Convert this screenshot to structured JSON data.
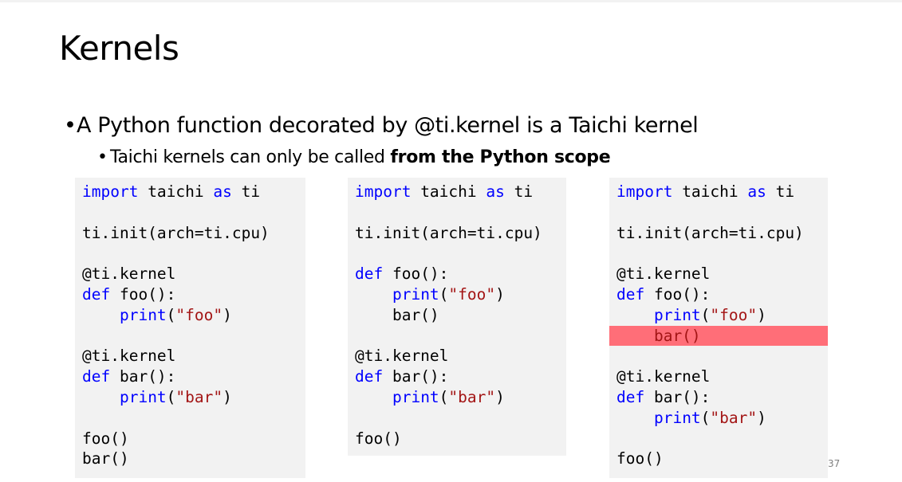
{
  "slide": {
    "title": "Kernels",
    "bullet_text": "A Python function decorated by @ti.kernel is a Taichi kernel",
    "sub_bullet_prefix": "Taichi kernels can only be called ",
    "sub_bullet_bold": "from the Python scope",
    "page_number": "37"
  },
  "code_blocks": [
    {
      "lines": [
        [
          {
            "t": "import",
            "c": "kw"
          },
          {
            "t": " taichi ",
            "c": "plain"
          },
          {
            "t": "as",
            "c": "kw"
          },
          {
            "t": " ti",
            "c": "plain"
          }
        ],
        [],
        [
          {
            "t": "ti.init(arch=ti.cpu)",
            "c": "plain"
          }
        ],
        [],
        [
          {
            "t": "@ti.kernel",
            "c": "plain"
          }
        ],
        [
          {
            "t": "def",
            "c": "kw"
          },
          {
            "t": " foo():",
            "c": "plain"
          }
        ],
        [
          {
            "t": "    ",
            "c": "plain"
          },
          {
            "t": "print",
            "c": "kw"
          },
          {
            "t": "(",
            "c": "plain"
          },
          {
            "t": "\"foo\"",
            "c": "str"
          },
          {
            "t": ")",
            "c": "plain"
          }
        ],
        [],
        [
          {
            "t": "@ti.kernel",
            "c": "plain"
          }
        ],
        [
          {
            "t": "def",
            "c": "kw"
          },
          {
            "t": " bar():",
            "c": "plain"
          }
        ],
        [
          {
            "t": "    ",
            "c": "plain"
          },
          {
            "t": "print",
            "c": "kw"
          },
          {
            "t": "(",
            "c": "plain"
          },
          {
            "t": "\"bar\"",
            "c": "str"
          },
          {
            "t": ")",
            "c": "plain"
          }
        ],
        [],
        [
          {
            "t": "foo()",
            "c": "plain"
          }
        ],
        [
          {
            "t": "bar()",
            "c": "plain"
          }
        ]
      ],
      "highlight_line": -1
    },
    {
      "lines": [
        [
          {
            "t": "import",
            "c": "kw"
          },
          {
            "t": " taichi ",
            "c": "plain"
          },
          {
            "t": "as",
            "c": "kw"
          },
          {
            "t": " ti",
            "c": "plain"
          }
        ],
        [],
        [
          {
            "t": "ti.init(arch=ti.cpu)",
            "c": "plain"
          }
        ],
        [],
        [
          {
            "t": "def",
            "c": "kw"
          },
          {
            "t": " foo():",
            "c": "plain"
          }
        ],
        [
          {
            "t": "    ",
            "c": "plain"
          },
          {
            "t": "print",
            "c": "kw"
          },
          {
            "t": "(",
            "c": "plain"
          },
          {
            "t": "\"foo\"",
            "c": "str"
          },
          {
            "t": ")",
            "c": "plain"
          }
        ],
        [
          {
            "t": "    bar()",
            "c": "plain"
          }
        ],
        [],
        [
          {
            "t": "@ti.kernel",
            "c": "plain"
          }
        ],
        [
          {
            "t": "def",
            "c": "kw"
          },
          {
            "t": " bar():",
            "c": "plain"
          }
        ],
        [
          {
            "t": "    ",
            "c": "plain"
          },
          {
            "t": "print",
            "c": "kw"
          },
          {
            "t": "(",
            "c": "plain"
          },
          {
            "t": "\"bar\"",
            "c": "str"
          },
          {
            "t": ")",
            "c": "plain"
          }
        ],
        [],
        [
          {
            "t": "foo()",
            "c": "plain"
          }
        ]
      ],
      "highlight_line": -1
    },
    {
      "lines": [
        [
          {
            "t": "import",
            "c": "kw"
          },
          {
            "t": " taichi ",
            "c": "plain"
          },
          {
            "t": "as",
            "c": "kw"
          },
          {
            "t": " ti",
            "c": "plain"
          }
        ],
        [],
        [
          {
            "t": "ti.init(arch=ti.cpu)",
            "c": "plain"
          }
        ],
        [],
        [
          {
            "t": "@ti.kernel",
            "c": "plain"
          }
        ],
        [
          {
            "t": "def",
            "c": "kw"
          },
          {
            "t": " foo():",
            "c": "plain"
          }
        ],
        [
          {
            "t": "    ",
            "c": "plain"
          },
          {
            "t": "print",
            "c": "kw"
          },
          {
            "t": "(",
            "c": "plain"
          },
          {
            "t": "\"foo\"",
            "c": "str"
          },
          {
            "t": ")",
            "c": "plain"
          }
        ],
        [
          {
            "t": "    bar()",
            "c": "str"
          }
        ],
        [],
        [
          {
            "t": "@ti.kernel",
            "c": "plain"
          }
        ],
        [
          {
            "t": "def",
            "c": "kw"
          },
          {
            "t": " bar():",
            "c": "plain"
          }
        ],
        [
          {
            "t": "    ",
            "c": "plain"
          },
          {
            "t": "print",
            "c": "kw"
          },
          {
            "t": "(",
            "c": "plain"
          },
          {
            "t": "\"bar\"",
            "c": "str"
          },
          {
            "t": ")",
            "c": "plain"
          }
        ],
        [],
        [
          {
            "t": "foo()",
            "c": "plain"
          }
        ]
      ],
      "highlight_line": 7
    }
  ],
  "colors": {
    "keyword": "#0000ff",
    "string": "#a31515",
    "highlight": "#ff6e78",
    "code_background": "#f2f2f2"
  }
}
